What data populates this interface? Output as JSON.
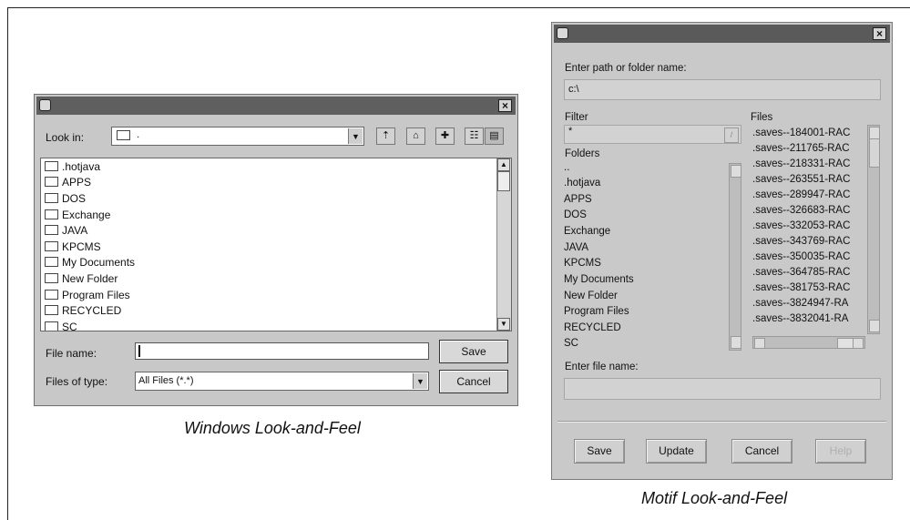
{
  "windows_dialog": {
    "look_in_label": "Look in:",
    "look_in_value": ".",
    "folders": [
      ".hotjava",
      "APPS",
      "DOS",
      "Exchange",
      "JAVA",
      "KPCMS",
      "My Documents",
      "New Folder",
      "Program Files",
      "RECYCLED",
      "SC"
    ],
    "file_name_label": "File name:",
    "file_name_value": "",
    "files_of_type_label": "Files of type:",
    "files_of_type_value": "All Files (*.*)",
    "save_label": "Save",
    "cancel_label": "Cancel",
    "caption": "Windows Look-and-Feel"
  },
  "motif_dialog": {
    "path_label": "Enter path or folder name:",
    "path_value": "c:\\",
    "filter_label": "Filter",
    "filter_value": "*",
    "files_label": "Files",
    "folders_label": "Folders",
    "folders": [
      "..",
      ".hotjava",
      "APPS",
      "DOS",
      "Exchange",
      "JAVA",
      "KPCMS",
      "My Documents",
      "New Folder",
      "Program Files",
      "RECYCLED",
      "SC"
    ],
    "files": [
      ".saves--184001-RAC",
      ".saves--211765-RAC",
      ".saves--218331-RAC",
      ".saves--263551-RAC",
      ".saves--289947-RAC",
      ".saves--326683-RAC",
      ".saves--332053-RAC",
      ".saves--343769-RAC",
      ".saves--350035-RAC",
      ".saves--364785-RAC",
      ".saves--381753-RAC",
      ".saves--3824947-RA",
      ".saves--3832041-RA"
    ],
    "file_name_label": "Enter file name:",
    "file_name_value": "",
    "save_label": "Save",
    "update_label": "Update",
    "cancel_label": "Cancel",
    "help_label": "Help",
    "caption": "Motif  Look-and-Feel"
  },
  "icons": {
    "title_app_icon": "coffee-cup-icon",
    "close": "close-icon",
    "dropdown": "chevron-down-icon",
    "up_folder": "up-folder-icon",
    "home": "home-icon",
    "new_folder": "new-folder-icon",
    "list_view": "list-view-icon",
    "details_view": "details-view-icon"
  }
}
